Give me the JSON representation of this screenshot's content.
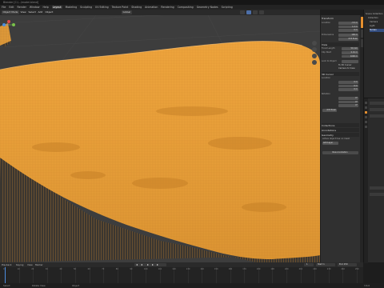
{
  "window": {
    "title": "Blender [C:\\...\\model.blend]"
  },
  "menubar": {
    "items": [
      "File",
      "Edit",
      "Render",
      "Window",
      "Help",
      "Layout",
      "Modeling",
      "Sculpting",
      "UV Editing",
      "Texture Paint",
      "Shading",
      "Animation",
      "Rendering",
      "Compositing",
      "Geometry Nodes",
      "Scripting"
    ],
    "active_index": 5
  },
  "viewport_header": {
    "shading_mode": "Object Mode",
    "view": "View",
    "select": "Select",
    "add": "Add",
    "object": "Object",
    "orientation": "Global"
  },
  "viewport": {
    "background_color": "#3d3d3d",
    "mesh_color": "#f0a53c",
    "mesh_dark_color": "#d18a2a",
    "wire_color": "#a86a1c",
    "icons": [
      "axis-gizmo-icon",
      "zoom-icon",
      "hand-pan-icon",
      "camera-view-icon",
      "grid-icon"
    ]
  },
  "npanel": {
    "item_section": "Item",
    "transform_section": "Transform",
    "location_label": "Location",
    "loc_x": "-3.5 m",
    "loc_y": "1.2 m",
    "loc_z": "0 m",
    "dimensions_label": "Dimensions",
    "dim_value": "100 m",
    "rotation_mode": "XYZ Euler",
    "view_section": "View",
    "focal_label": "Focal Length",
    "focal_value": "50 mm",
    "clip_label": "Clip Start",
    "clip_start": "0.01 m",
    "clip_end": "1000 m",
    "lock_label": "Lock to Object",
    "lock_cursor": "To 3D Cursor",
    "camera_to_view": "Camera to View",
    "cursor_section": "3D Cursor",
    "location2_label": "Location",
    "cx": "0 m",
    "cy": "0 m",
    "cz": "0 m",
    "rotation_label": "Rotation",
    "rx": "0°",
    "ry": "0°",
    "rz": "0°",
    "euler_mode": "XYZ Euler",
    "collections_section": "Collections",
    "annotations_section": "Annotations",
    "geometry_section": "Geometry",
    "geometry_note": "Active object has no mesh",
    "add_button": "Add Layer",
    "new_button": "New Annotation"
  },
  "outliner": {
    "items": [
      "Scene Collection",
      "Collection",
      "Camera",
      "Light",
      "Terrain"
    ],
    "active_index": 4
  },
  "timeline": {
    "header": {
      "playback": "Playback",
      "keying": "Keying",
      "view": "View",
      "marker": "Marker"
    },
    "frame_current": "1",
    "start": "Start 1",
    "end": "End 250",
    "ticks": [
      "0",
      "10",
      "20",
      "30",
      "40",
      "50",
      "60",
      "70",
      "80",
      "90",
      "100",
      "110",
      "120",
      "130",
      "140",
      "150",
      "160",
      "170",
      "180",
      "190",
      "200",
      "210",
      "220",
      "230",
      "240",
      "250"
    ]
  },
  "statusbar": {
    "left": "Select",
    "middle": "Rotate View",
    "right": "Object",
    "version": "3.6.0"
  },
  "colors": {
    "accent": "#e48f2f",
    "panel": "#303030",
    "header": "#2a2a2a"
  }
}
